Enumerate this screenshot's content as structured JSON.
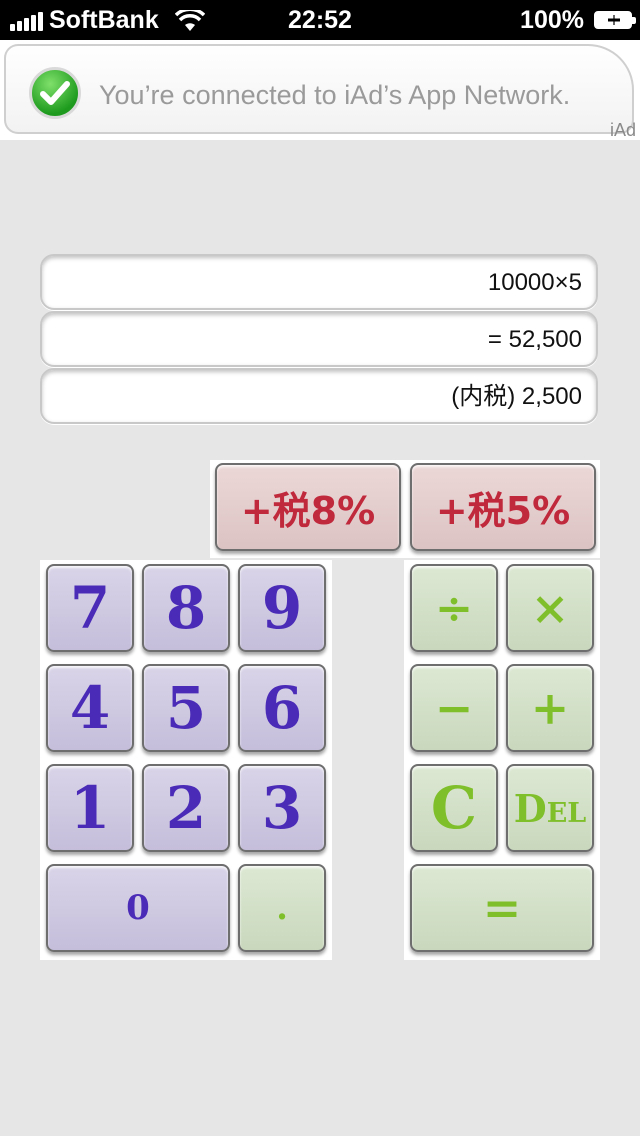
{
  "status_bar": {
    "carrier": "SoftBank",
    "time": "22:52",
    "battery_percent": "100%"
  },
  "ad_banner": {
    "message": "You’re connected to iAd’s App Network.",
    "brand": "iAd"
  },
  "display": {
    "expression": "10000×5",
    "result": "= 52,500",
    "tax_included": "(内税) 2,500"
  },
  "tax_buttons": {
    "tax8": "+税8%",
    "tax5": "+税5%"
  },
  "keypad": {
    "digits": [
      "7",
      "8",
      "9",
      "4",
      "5",
      "6",
      "1",
      "2",
      "3"
    ],
    "zero": "0",
    "decimal": "."
  },
  "operators": {
    "divide": "÷",
    "multiply": "×",
    "minus": "−",
    "plus": "+",
    "clear": "C",
    "delete": "Del",
    "equals": "="
  },
  "colors": {
    "digit_text": "#4a2bb8",
    "operator_text": "#7fbf2a",
    "tax_text": "#c0283b",
    "check_green": "#1e9b1e"
  }
}
